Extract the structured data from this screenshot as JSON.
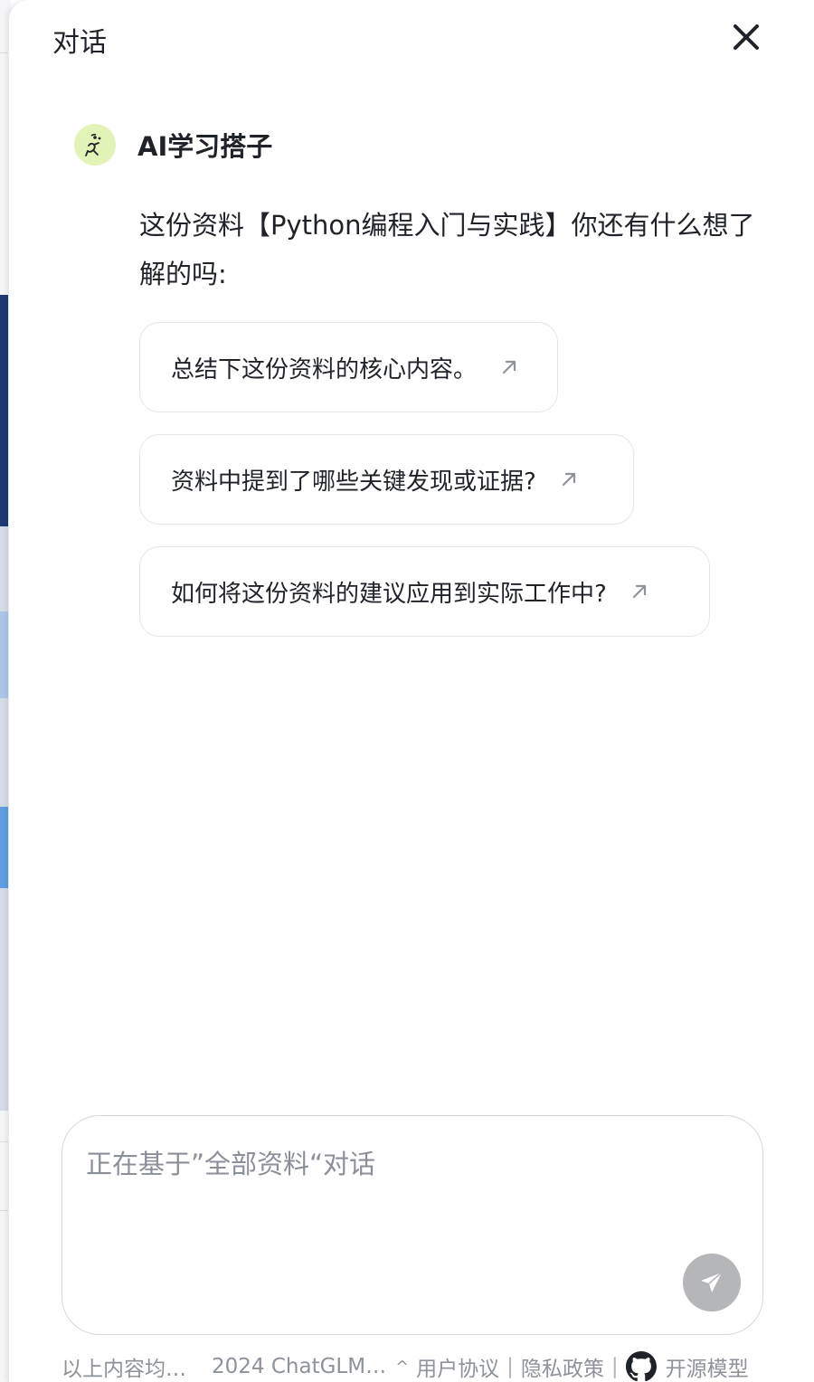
{
  "panel": {
    "title": "对话"
  },
  "bot": {
    "name": "AI学习搭子",
    "message": "这份资料【Python编程入门与实践】你还有什么想了解的吗:"
  },
  "suggestions": [
    {
      "label": "总结下这份资料的核心内容。"
    },
    {
      "label": "资料中提到了哪些关键发现或证据?"
    },
    {
      "label": "如何将这份资料的建议应用到实际工作中?"
    }
  ],
  "input": {
    "placeholder": "正在基于”全部资料“对话",
    "value": ""
  },
  "footer": {
    "disclaimer": "以上内容均…",
    "copyright": "2024 ChatGLM…",
    "caret": "^",
    "user_agreement": "用户协议",
    "privacy_policy": "隐私政策",
    "open_source": "开源模型",
    "separator": "|"
  },
  "colors": {
    "avatar_bg": "#e2f3b7",
    "send_button_disabled": "#b4b6ba",
    "text_primary": "#1f2329",
    "text_muted": "#8d929b"
  },
  "icons": {
    "close": "close-icon",
    "arrow": "arrow-up-right-icon",
    "send": "send-icon",
    "github": "github-icon",
    "avatar": "mascot-avatar-icon"
  }
}
